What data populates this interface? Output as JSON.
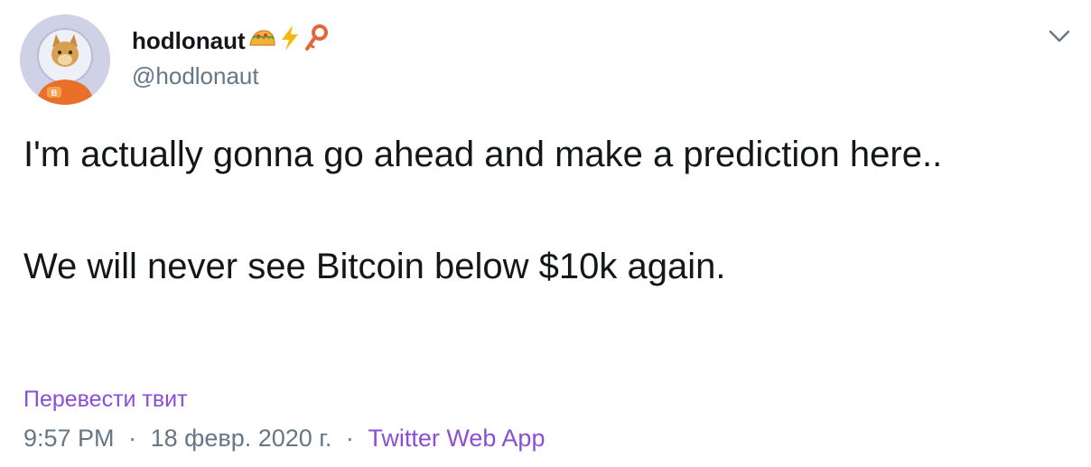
{
  "author": {
    "display_name": "hodlonaut",
    "handle": "@hodlonaut",
    "avatar_icon": "astronaut-cat-avatar",
    "name_emojis": [
      "taco-icon",
      "lightning-icon",
      "key-icon"
    ]
  },
  "tweet": {
    "line1": "I'm actually gonna go ahead and make a prediction here..",
    "line2": "We will never see Bitcoin below $10k again."
  },
  "translate_label": "Перевести твит",
  "meta": {
    "time": "9:57 PM",
    "separator": "·",
    "date": "18 февр. 2020 г.",
    "source": "Twitter Web App"
  },
  "colors": {
    "text": "#14171a",
    "secondary": "#657786",
    "link": "#8a4fd6"
  }
}
